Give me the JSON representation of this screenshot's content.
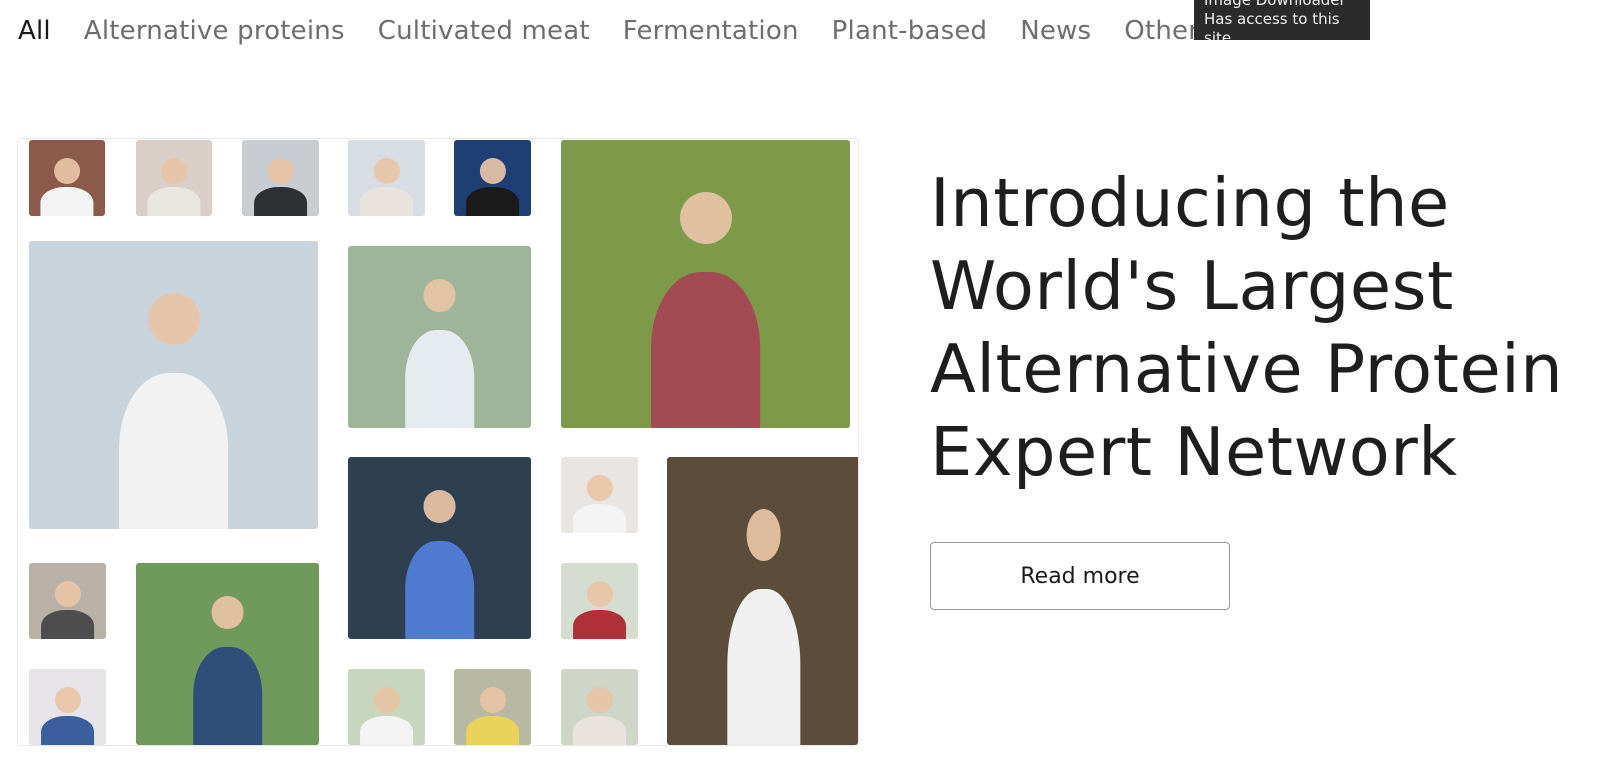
{
  "tabs": [
    {
      "label": "All",
      "active": true
    },
    {
      "label": "Alternative proteins",
      "active": false
    },
    {
      "label": "Cultivated meat",
      "active": false
    },
    {
      "label": "Fermentation",
      "active": false
    },
    {
      "label": "Plant-based",
      "active": false
    },
    {
      "label": "News",
      "active": false
    },
    {
      "label": "Other",
      "active": false
    }
  ],
  "tooltip": {
    "title": "Image Downloader",
    "subtitle": "Has access to this site"
  },
  "hero": {
    "title_lines": [
      "Introducing the",
      "World's Largest",
      "Alternative Protein",
      "Expert Network"
    ],
    "read_more_label": "Read more"
  },
  "mosaic": {
    "photos": [
      {
        "name": "photo-man-glasses-portrait",
        "bg": "#8c5a4a",
        "body": "#f3f3f3"
      },
      {
        "name": "photo-woman-curly-hair-portrait",
        "bg": "#d9cfc8",
        "body": "#eae6e0"
      },
      {
        "name": "photo-man-glasses-dark-jacket-portrait",
        "bg": "#c9ccd0",
        "body": "#2e3134"
      },
      {
        "name": "photo-woman-on-phone-portrait",
        "bg": "#d8dde3",
        "body": "#e9e3dd"
      },
      {
        "name": "photo-woman-blazer-portrait",
        "bg": "#1f3e73",
        "body": "#1a1a1a"
      },
      {
        "name": "photo-farmer-with-tablet",
        "bg": "#7c9a4a",
        "body": "#a34a52"
      },
      {
        "name": "photo-scientist-lab-coat-clipboard",
        "bg": "#c8d3dc",
        "body": "#f2f2f2"
      },
      {
        "name": "photo-researcher-inspecting-plants",
        "bg": "#9fb59a",
        "body": "#e6ebef"
      },
      {
        "name": "photo-lab-microscope",
        "bg": "#2f3f52",
        "body": "#4f7bd0"
      },
      {
        "name": "photo-woman-bending-portrait",
        "bg": "#e9e5e2",
        "body": "#f4f4f4"
      },
      {
        "name": "photo-lab-worker-machinery",
        "bg": "#5c4c3a",
        "body": "#f0f0f0"
      },
      {
        "name": "photo-two-women-laptop",
        "bg": "#b9b0a6",
        "body": "#4d4d4d"
      },
      {
        "name": "photo-farmer-woman-tablet-field",
        "bg": "#6f9a5c",
        "body": "#2f4f7a"
      },
      {
        "name": "photo-worker-red-shirt-greenhouse",
        "bg": "#d5ddd0",
        "body": "#b0303a"
      },
      {
        "name": "photo-girl-safety-glasses",
        "bg": "#e6e4e6",
        "body": "#3b5f9c"
      },
      {
        "name": "photo-woman-lab-coat-greenhouse",
        "bg": "#c8d6c0",
        "body": "#f3f3f3"
      },
      {
        "name": "photo-sticky-notes-board",
        "bg": "#b7b9a3",
        "body": "#e9d35a"
      },
      {
        "name": "photo-smiling-woman-portrait",
        "bg": "#cfd5c7",
        "body": "#e9e3dd"
      }
    ]
  }
}
